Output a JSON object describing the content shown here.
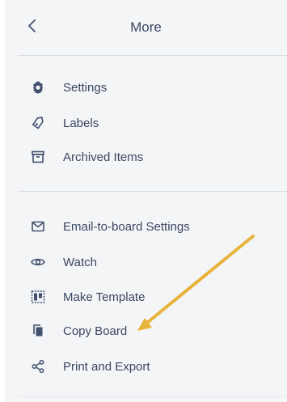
{
  "header": {
    "title": "More"
  },
  "group1": [
    {
      "label": "Settings",
      "icon": "gear-icon"
    },
    {
      "label": "Labels",
      "icon": "tag-icon"
    },
    {
      "label": "Archived Items",
      "icon": "archive-icon"
    }
  ],
  "group2": [
    {
      "label": "Email-to-board Settings",
      "icon": "envelope-icon"
    },
    {
      "label": "Watch",
      "icon": "eye-icon"
    },
    {
      "label": "Make Template",
      "icon": "template-icon"
    },
    {
      "label": "Copy Board",
      "icon": "copy-icon"
    },
    {
      "label": "Print and Export",
      "icon": "share-icon"
    }
  ],
  "colors": {
    "panel_bg": "#f4f5f7",
    "text": "#3a4660",
    "arrow": "#e8b33a"
  }
}
